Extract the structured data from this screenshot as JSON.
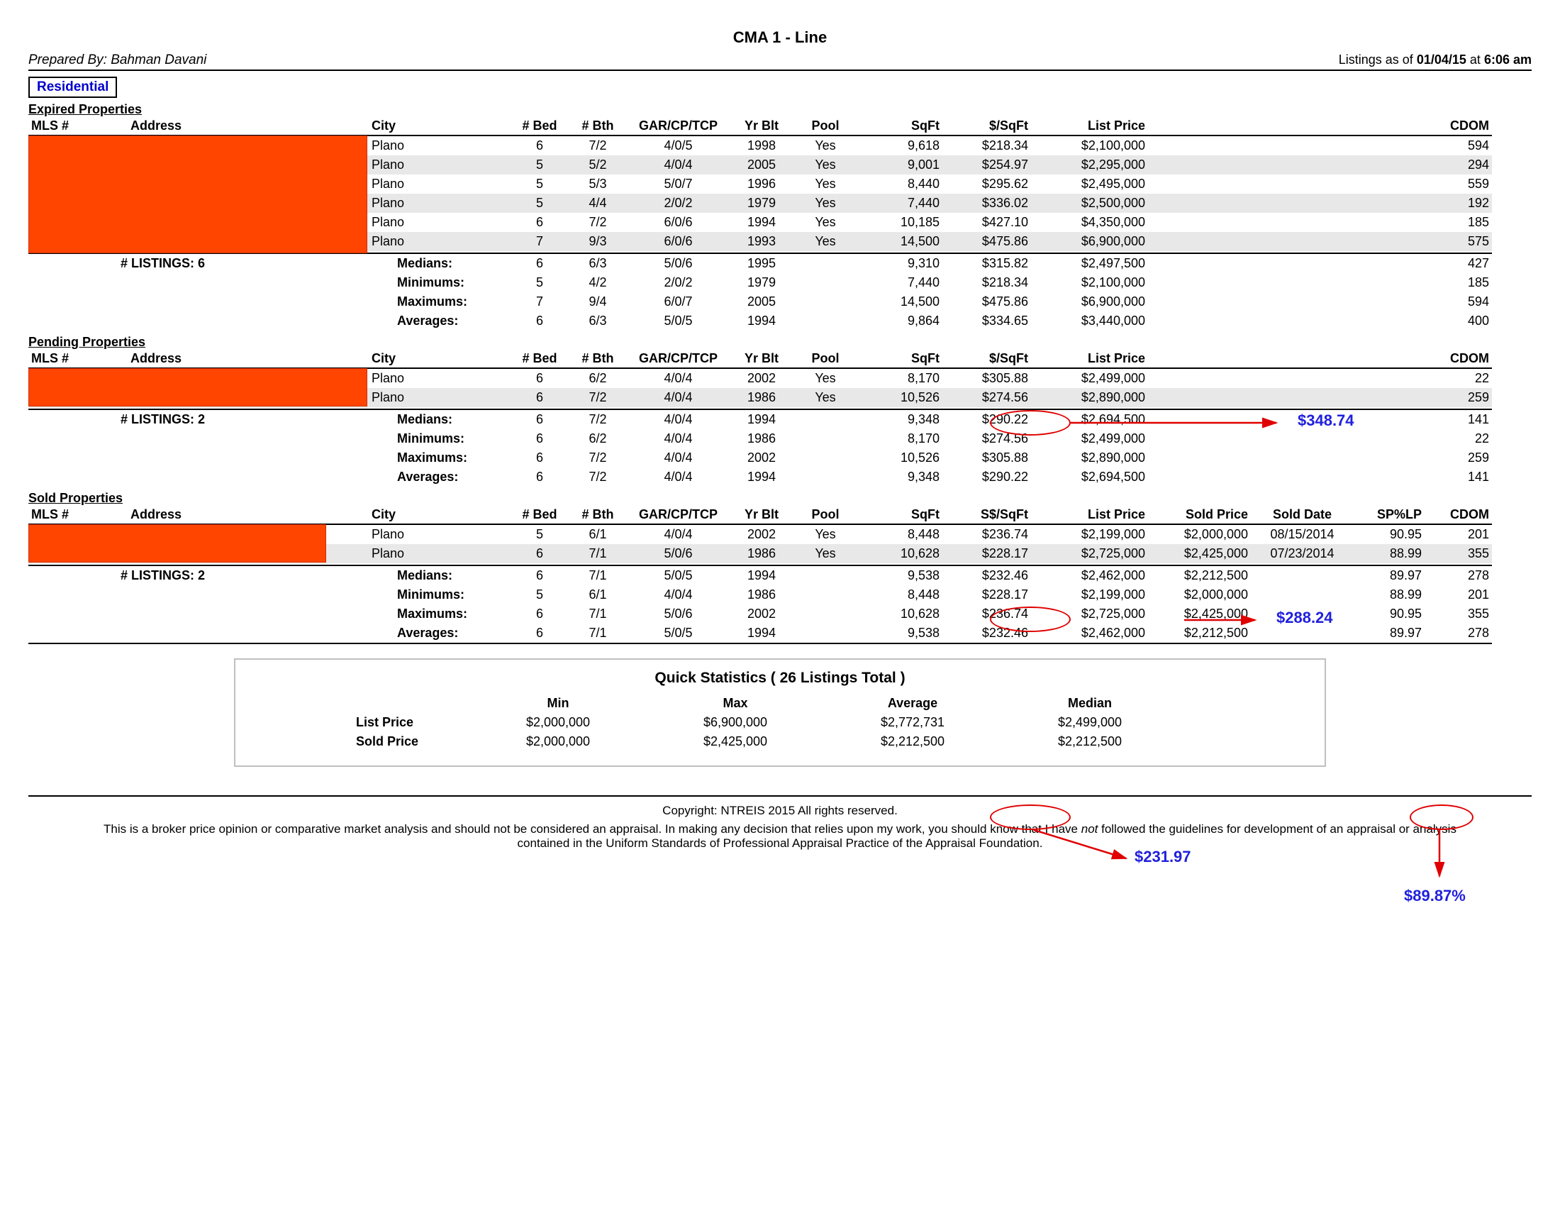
{
  "title": "CMA 1 - Line",
  "prepared_by_label": "Prepared By:",
  "prepared_by_name": "Bahman Davani",
  "as_of_label": "Listings as of",
  "as_of_date": "01/04/15",
  "as_of_at": "at",
  "as_of_time": "6:06 am",
  "residential": "Residential",
  "columns": {
    "mls": "MLS #",
    "address": "Address",
    "city": "City",
    "bed": "# Bed",
    "bth": "# Bth",
    "gar": "GAR/CP/TCP",
    "yrblt": "Yr Blt",
    "pool": "Pool",
    "sqft": "SqFt",
    "psqft": "$/SqFt",
    "spsqft": "S$/SqFt",
    "listprice": "List Price",
    "soldprice": "Sold Price",
    "solddate": "Sold Date",
    "splp": "SP%LP",
    "cdom": "CDOM"
  },
  "sections": {
    "expired": {
      "title": "Expired Properties",
      "rows": [
        {
          "city": "Plano",
          "bed": "6",
          "bth": "7/2",
          "gar": "4/0/5",
          "yr": "1998",
          "pool": "Yes",
          "sqft": "9,618",
          "psqft": "$218.34",
          "lp": "$2,100,000",
          "cdom": "594"
        },
        {
          "city": "Plano",
          "bed": "5",
          "bth": "5/2",
          "gar": "4/0/4",
          "yr": "2005",
          "pool": "Yes",
          "sqft": "9,001",
          "psqft": "$254.97",
          "lp": "$2,295,000",
          "cdom": "294"
        },
        {
          "city": "Plano",
          "bed": "5",
          "bth": "5/3",
          "gar": "5/0/7",
          "yr": "1996",
          "pool": "Yes",
          "sqft": "8,440",
          "psqft": "$295.62",
          "lp": "$2,495,000",
          "cdom": "559"
        },
        {
          "city": "Plano",
          "bed": "5",
          "bth": "4/4",
          "gar": "2/0/2",
          "yr": "1979",
          "pool": "Yes",
          "sqft": "7,440",
          "psqft": "$336.02",
          "lp": "$2,500,000",
          "cdom": "192"
        },
        {
          "city": "Plano",
          "bed": "6",
          "bth": "7/2",
          "gar": "6/0/6",
          "yr": "1994",
          "pool": "Yes",
          "sqft": "10,185",
          "psqft": "$427.10",
          "lp": "$4,350,000",
          "cdom": "185"
        },
        {
          "city": "Plano",
          "bed": "7",
          "bth": "9/3",
          "gar": "6/0/6",
          "yr": "1993",
          "pool": "Yes",
          "sqft": "14,500",
          "psqft": "$475.86",
          "lp": "$6,900,000",
          "cdom": "575"
        }
      ],
      "listings_count": "6",
      "stats": [
        {
          "label": "Medians:",
          "bed": "6",
          "bth": "6/3",
          "gar": "5/0/6",
          "yr": "1995",
          "sqft": "9,310",
          "psqft": "$315.82",
          "lp": "$2,497,500",
          "cdom": "427"
        },
        {
          "label": "Minimums:",
          "bed": "5",
          "bth": "4/2",
          "gar": "2/0/2",
          "yr": "1979",
          "sqft": "7,440",
          "psqft": "$218.34",
          "lp": "$2,100,000",
          "cdom": "185"
        },
        {
          "label": "Maximums:",
          "bed": "7",
          "bth": "9/4",
          "gar": "6/0/7",
          "yr": "2005",
          "sqft": "14,500",
          "psqft": "$475.86",
          "lp": "$6,900,000",
          "cdom": "594"
        },
        {
          "label": "Averages:",
          "bed": "6",
          "bth": "6/3",
          "gar": "5/0/5",
          "yr": "1994",
          "sqft": "9,864",
          "psqft": "$334.65",
          "lp": "$3,440,000",
          "cdom": "400"
        }
      ]
    },
    "pending": {
      "title": "Pending Properties",
      "rows": [
        {
          "city": "Plano",
          "bed": "6",
          "bth": "6/2",
          "gar": "4/0/4",
          "yr": "2002",
          "pool": "Yes",
          "sqft": "8,170",
          "psqft": "$305.88",
          "lp": "$2,499,000",
          "cdom": "22"
        },
        {
          "city": "Plano",
          "bed": "6",
          "bth": "7/2",
          "gar": "4/0/4",
          "yr": "1986",
          "pool": "Yes",
          "sqft": "10,526",
          "psqft": "$274.56",
          "lp": "$2,890,000",
          "cdom": "259"
        }
      ],
      "listings_count": "2",
      "stats": [
        {
          "label": "Medians:",
          "bed": "6",
          "bth": "7/2",
          "gar": "4/0/4",
          "yr": "1994",
          "sqft": "9,348",
          "psqft": "$290.22",
          "lp": "$2,694,500",
          "cdom": "141"
        },
        {
          "label": "Minimums:",
          "bed": "6",
          "bth": "6/2",
          "gar": "4/0/4",
          "yr": "1986",
          "sqft": "8,170",
          "psqft": "$274.56",
          "lp": "$2,499,000",
          "cdom": "22"
        },
        {
          "label": "Maximums:",
          "bed": "6",
          "bth": "7/2",
          "gar": "4/0/4",
          "yr": "2002",
          "sqft": "10,526",
          "psqft": "$305.88",
          "lp": "$2,890,000",
          "cdom": "259"
        },
        {
          "label": "Averages:",
          "bed": "6",
          "bth": "7/2",
          "gar": "4/0/4",
          "yr": "1994",
          "sqft": "9,348",
          "psqft": "$290.22",
          "lp": "$2,694,500",
          "cdom": "141"
        }
      ]
    },
    "sold": {
      "title": "Sold Properties",
      "rows": [
        {
          "city": "Plano",
          "bed": "5",
          "bth": "6/1",
          "gar": "4/0/4",
          "yr": "2002",
          "pool": "Yes",
          "sqft": "8,448",
          "psqft": "$236.74",
          "lp": "$2,199,000",
          "sp": "$2,000,000",
          "sd": "08/15/2014",
          "splp": "90.95",
          "cdom": "201"
        },
        {
          "city": "Plano",
          "bed": "6",
          "bth": "7/1",
          "gar": "5/0/6",
          "yr": "1986",
          "pool": "Yes",
          "sqft": "10,628",
          "psqft": "$228.17",
          "lp": "$2,725,000",
          "sp": "$2,425,000",
          "sd": "07/23/2014",
          "splp": "88.99",
          "cdom": "355"
        }
      ],
      "listings_count": "2",
      "stats": [
        {
          "label": "Medians:",
          "bed": "6",
          "bth": "7/1",
          "gar": "5/0/5",
          "yr": "1994",
          "sqft": "9,538",
          "psqft": "$232.46",
          "lp": "$2,462,000",
          "sp": "$2,212,500",
          "splp": "89.97",
          "cdom": "278"
        },
        {
          "label": "Minimums:",
          "bed": "5",
          "bth": "6/1",
          "gar": "4/0/4",
          "yr": "1986",
          "sqft": "8,448",
          "psqft": "$228.17",
          "lp": "$2,199,000",
          "sp": "$2,000,000",
          "splp": "88.99",
          "cdom": "201"
        },
        {
          "label": "Maximums:",
          "bed": "6",
          "bth": "7/1",
          "gar": "5/0/6",
          "yr": "2002",
          "sqft": "10,628",
          "psqft": "$236.74",
          "lp": "$2,725,000",
          "sp": "$2,425,000",
          "splp": "90.95",
          "cdom": "355"
        },
        {
          "label": "Averages:",
          "bed": "6",
          "bth": "7/1",
          "gar": "5/0/5",
          "yr": "1994",
          "sqft": "9,538",
          "psqft": "$232.46",
          "lp": "$2,462,000",
          "sp": "$2,212,500",
          "splp": "89.97",
          "cdom": "278"
        }
      ]
    }
  },
  "listings_label": "# LISTINGS:",
  "annotations": {
    "a1": "$348.74",
    "a2": "$288.24",
    "a3": "$231.97",
    "a4": "$89.87%"
  },
  "quick": {
    "title": "Quick Statistics  ( 26 Listings Total )",
    "cols": [
      "Min",
      "Max",
      "Average",
      "Median"
    ],
    "rows": [
      {
        "label": "List Price",
        "vals": [
          "$2,000,000",
          "$6,900,000",
          "$2,772,731",
          "$2,499,000"
        ]
      },
      {
        "label": "Sold Price",
        "vals": [
          "$2,000,000",
          "$2,425,000",
          "$2,212,500",
          "$2,212,500"
        ]
      }
    ]
  },
  "copyright": "Copyright: NTREIS 2015 All rights reserved.",
  "disclaimer1": "This is a broker price opinion or comparative market analysis and should not be considered an appraisal. In making any decision that relies upon my work, you should know that I have",
  "disclaimer_not": "not",
  "disclaimer2": " followed the guidelines for development of an appraisal or analysis contained in the Uniform Standards of Professional Appraisal Practice of the Appraisal Foundation."
}
